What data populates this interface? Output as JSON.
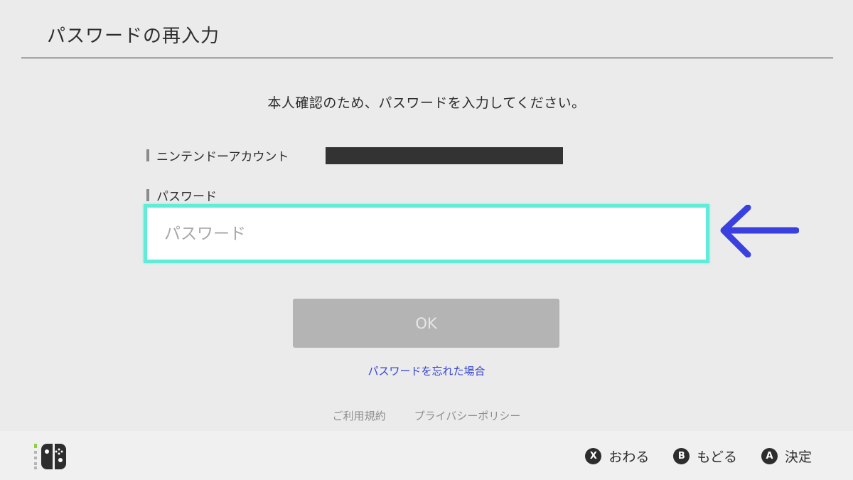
{
  "header": {
    "title": "パスワードの再入力"
  },
  "main": {
    "instruction": "本人確認のため、パスワードを入力してください。",
    "account_label": "ニンテンドーアカウント",
    "password_label": "パスワード",
    "password_placeholder": "パスワード",
    "password_value": "",
    "ok_label": "OK",
    "forgot_link": "パスワードを忘れた場合",
    "legal_links": [
      "ご利用規約",
      "プライバシーポリシー"
    ]
  },
  "annotation": {
    "arrow_icon": "left-arrow-icon",
    "arrow_color": "#3a3fe0"
  },
  "footer": {
    "controller_icon": "joy-con-icon",
    "hints": [
      {
        "button": "X",
        "label": "おわる"
      },
      {
        "button": "B",
        "label": "もどる"
      },
      {
        "button": "A",
        "label": "決定"
      }
    ]
  },
  "colors": {
    "focus_border": "#60ecd9",
    "link": "#3342d6",
    "ok_disabled_bg": "#b4b4b4"
  }
}
